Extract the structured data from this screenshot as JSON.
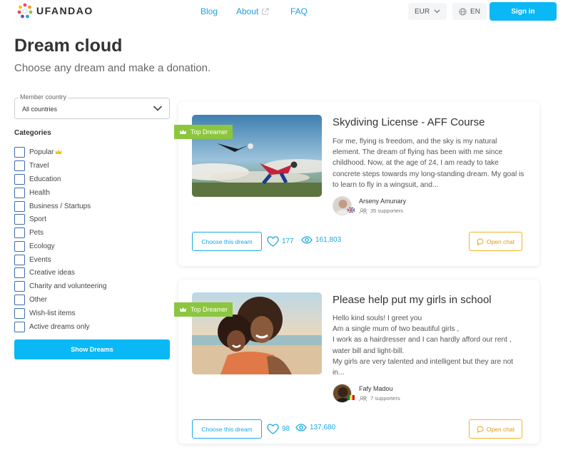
{
  "header": {
    "logo_text": "UFANDAO",
    "nav": [
      {
        "label": "Blog"
      },
      {
        "label": "About"
      },
      {
        "label": "FAQ"
      }
    ],
    "currency": "EUR",
    "language": "EN",
    "signin_label": "Sign in"
  },
  "page": {
    "title": "Dream cloud",
    "subtitle": "Choose any dream and make a donation."
  },
  "sidebar": {
    "country_label": "Member country",
    "country_value": "All countries",
    "categories_title": "Categories",
    "categories": [
      {
        "label": "Popular"
      },
      {
        "label": "Travel"
      },
      {
        "label": "Education"
      },
      {
        "label": "Health"
      },
      {
        "label": "Business / Startups"
      },
      {
        "label": "Sport"
      },
      {
        "label": "Pets"
      },
      {
        "label": "Ecology"
      },
      {
        "label": "Events"
      },
      {
        "label": "Creative ideas"
      },
      {
        "label": "Charity and volunteering"
      },
      {
        "label": "Other"
      },
      {
        "label": "Wish-list items"
      },
      {
        "label": "Active dreams only"
      }
    ],
    "show_button": "Show Dreams"
  },
  "dreams": [
    {
      "badge": "Top Dreamer",
      "title": "Skydiving License - AFF Course",
      "description": [
        "For me, flying is freedom, and the sky is my natural element. The dream of flying has been with me since childhood. Now, at the age of 24, I am ready to take concrete steps towards my long-standing dream. My goal is to learn to fly in a wingsuit, and..."
      ],
      "author": "Arseny Amunary",
      "supporters": "35 supporters",
      "choose_label": "Choose this dream",
      "likes": "177",
      "views": "161,803",
      "chat_label": "Open chat"
    },
    {
      "badge": "Top Dreamer",
      "title": "Please help put my girls in school",
      "description": [
        "Hello kind souls! I greet you",
        "Am a single mum of two beautiful girls ,",
        "I work as a hairdresser and I can hardly afford our rent , water bill and light-bill.",
        "My girls are very talented and intelligent but they are not in..."
      ],
      "author": "Fafy Madou",
      "supporters": "7 supporters",
      "choose_label": "Choose this dream",
      "likes": "98",
      "views": "137,680",
      "chat_label": "Open chat"
    }
  ],
  "colors": {
    "accent": "#0ab8f5",
    "link": "#1aa0e6",
    "badge": "#8cc63f",
    "chat": "#f0b323"
  }
}
